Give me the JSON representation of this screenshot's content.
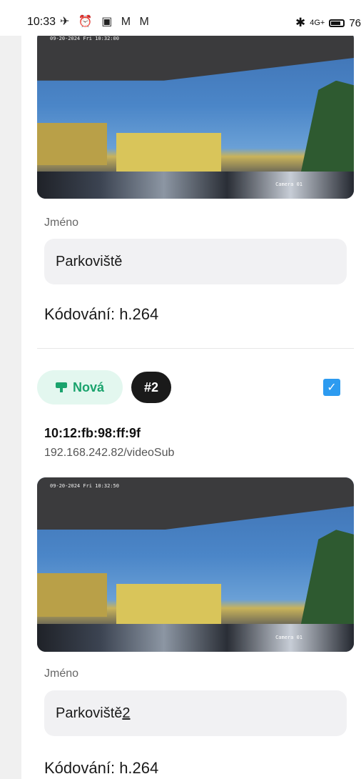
{
  "status_bar": {
    "time": "10:33",
    "left_icons": [
      "notification-off-icon",
      "alarm-icon",
      "nfc-icon",
      "mail-icon",
      "mail-icon"
    ],
    "left_glyphs": "✈ ⏰ ▣ M M",
    "bluetooth_glyph": "✱",
    "signal_text": "4G+",
    "battery": "76"
  },
  "camera_1": {
    "timestamp": "09-20-2024 Fri 10:32:00",
    "overlay_label": "Camera 01",
    "name_label": "Jméno",
    "name_value": "Parkoviště",
    "coding": "Kódování: h.264"
  },
  "camera_2": {
    "status_badge": "Nová",
    "index_badge": "#2",
    "checked": true,
    "check_glyph": "✓",
    "mac": "10:12:fb:98:ff:9f",
    "url": "192.168.242.82/videoSub",
    "timestamp": "09-20-2024 Fri 10:32:50",
    "overlay_label": "Camera 01",
    "name_label": "Jméno",
    "name_value_main": "Parkoviště ",
    "name_value_underlined": "2",
    "coding": "Kódování: h.264"
  },
  "colors": {
    "accent_green": "#1aa36d",
    "badge_green_bg": "#e3f7ef",
    "checkbox_blue": "#2d9bf0"
  }
}
